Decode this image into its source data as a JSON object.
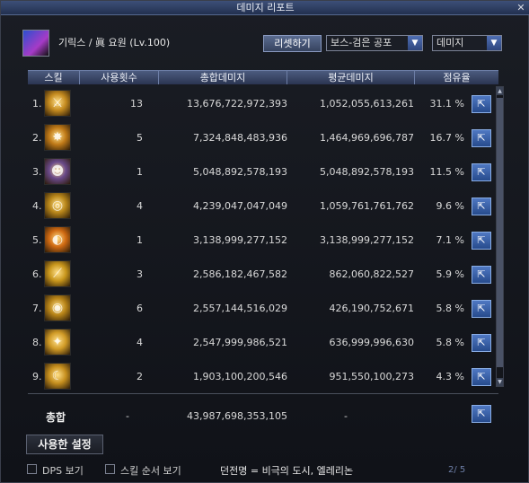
{
  "window": {
    "title": "데미지 리포트",
    "close_glyph": "✕"
  },
  "character": {
    "name": "기릭스 / 眞 요원 (Lv.100)"
  },
  "controls": {
    "reset_label": "리셋하기",
    "target_select": "보스-검은 공포",
    "type_select": "데미지",
    "arrow_glyph": "▼"
  },
  "columns": [
    "스킬",
    "사용횟수",
    "총합데미지",
    "평균데미지",
    "점유율"
  ],
  "rows": [
    {
      "rank": "1.",
      "icon": "sword-slash-skill-icon",
      "glyph": "⚔",
      "color": "#c48a1f",
      "count": "13",
      "total": "13,676,722,972,393",
      "avg": "1,052,055,613,261",
      "share": "31.1 %"
    },
    {
      "rank": "2.",
      "icon": "emblem-skill-icon",
      "glyph": "✸",
      "color": "#c07a18",
      "count": "5",
      "total": "7,324,848,483,936",
      "avg": "1,464,969,696,787",
      "share": "16.7 %"
    },
    {
      "rank": "3.",
      "icon": "agent-portrait-skill-icon",
      "glyph": "☻",
      "color": "#6a4a8a",
      "count": "1",
      "total": "5,048,892,578,193",
      "avg": "5,048,892,578,193",
      "share": "11.5 %"
    },
    {
      "rank": "4.",
      "icon": "whirlwind-skill-icon",
      "glyph": "◎",
      "color": "#b8861a",
      "count": "4",
      "total": "4,239,047,047,049",
      "avg": "1,059,761,761,762",
      "share": "9.6 %"
    },
    {
      "rank": "5.",
      "icon": "orb-slash-skill-icon",
      "glyph": "◐",
      "color": "#d06a12",
      "count": "1",
      "total": "3,138,999,277,152",
      "avg": "3,138,999,277,152",
      "share": "7.1 %"
    },
    {
      "rank": "6.",
      "icon": "diagonal-strike-skill-icon",
      "glyph": "⟋",
      "color": "#c8961c",
      "count": "3",
      "total": "2,586,182,467,582",
      "avg": "862,060,822,527",
      "share": "5.9 %"
    },
    {
      "rank": "7.",
      "icon": "target-burst-skill-icon",
      "glyph": "◉",
      "color": "#b88418",
      "count": "6",
      "total": "2,557,144,516,029",
      "avg": "426,190,752,671",
      "share": "5.8 %"
    },
    {
      "rank": "8.",
      "icon": "radiant-dash-skill-icon",
      "glyph": "✦",
      "color": "#d09a26",
      "count": "4",
      "total": "2,547,999,986,521",
      "avg": "636,999,996,630",
      "share": "5.8 %"
    },
    {
      "rank": "9.",
      "icon": "crescent-skill-icon",
      "glyph": "☾",
      "color": "#c68f1e",
      "count": "2",
      "total": "1,903,100,200,546",
      "avg": "951,550,100,273",
      "share": "4.3 %"
    }
  ],
  "share_button_glyph": "⇱",
  "summary": {
    "label": "총합",
    "count": "-",
    "total": "43,987,698,353,105",
    "avg": "-"
  },
  "footer": {
    "used_settings_label": "사용한 설정",
    "dps_label": "DPS 보기",
    "skill_order_label": "스킬 순서 보기",
    "dungeon_text": "던전명 = 비극의 도시, 엘레리논",
    "page_text": "2/ 5"
  }
}
